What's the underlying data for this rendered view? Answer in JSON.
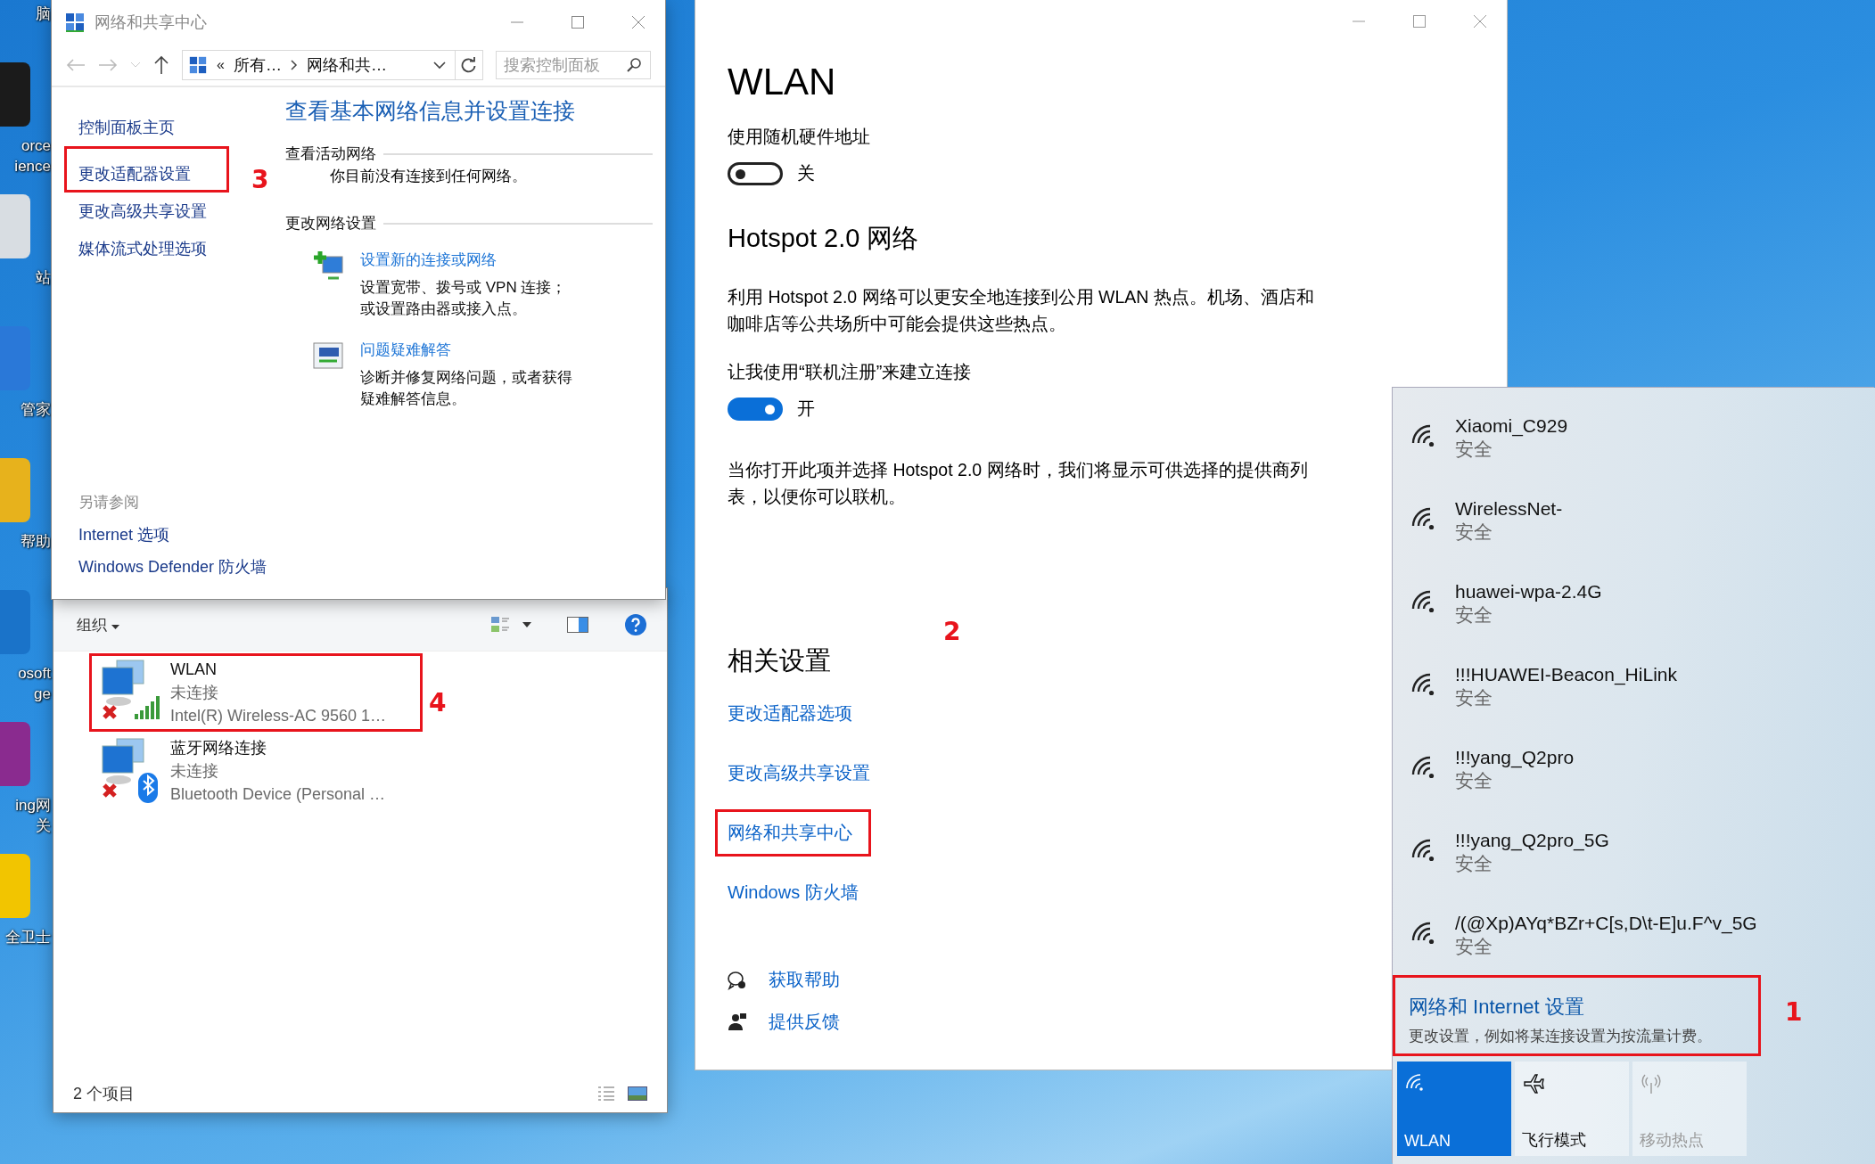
{
  "desktop_icons": [
    {
      "lines": [
        "脑"
      ]
    },
    {
      "lines": [
        "orce",
        "ience"
      ]
    },
    {
      "lines": [
        "站"
      ]
    },
    {
      "lines": [
        "管家"
      ]
    },
    {
      "lines": [
        "帮助"
      ]
    },
    {
      "lines": [
        "osoft",
        "ge"
      ]
    },
    {
      "lines": [
        "ing网",
        "关"
      ]
    },
    {
      "lines": [
        "全卫士"
      ]
    }
  ],
  "control_panel": {
    "title": "网络和共享中心",
    "breadcrumb_prefix": "«",
    "breadcrumb": [
      "所有…",
      "网络和共…"
    ],
    "search": {
      "placeholder": "搜索控制面板"
    },
    "nav": [
      {
        "label": "控制面板主页"
      },
      {
        "label": "更改适配器设置",
        "annotation": "3"
      },
      {
        "label": "更改高级共享设置"
      },
      {
        "label": "媒体流式处理选项"
      }
    ],
    "heading": "查看基本网络信息并设置连接",
    "active_networks": {
      "title": "查看活动网络",
      "text": "你目前没有连接到任何网络。"
    },
    "change_settings": {
      "title": "更改网络设置",
      "tasks": [
        {
          "kind": "new-connection",
          "link": "设置新的连接或网络",
          "lines": [
            "设置宽带、拨号或 VPN 连接；",
            "或设置路由器或接入点。"
          ]
        },
        {
          "kind": "troubleshoot",
          "link": "问题疑难解答",
          "lines": [
            "诊断并修复网络问题，或者获得",
            "疑难解答信息。"
          ]
        }
      ]
    },
    "see_also": {
      "title": "另请参阅",
      "links": [
        "Internet 选项",
        "Windows Defender 防火墙"
      ]
    }
  },
  "connections_window": {
    "organize": "组织",
    "items": [
      {
        "kind": "wifi",
        "name": "WLAN",
        "status": "未连接",
        "device": "Intel(R) Wireless-AC 9560 1…",
        "annotation": "4"
      },
      {
        "kind": "bluetooth",
        "name": "蓝牙网络连接",
        "status": "未连接",
        "device": "Bluetooth Device (Personal …"
      }
    ],
    "status": "2 个项目"
  },
  "settings": {
    "title": "WLAN",
    "random_address": {
      "label": "使用随机硬件地址",
      "on": false,
      "state": "关"
    },
    "hotspot": {
      "heading": "Hotspot 2.0 网络",
      "description": "利用 Hotspot 2.0 网络可以更安全地连接到公用 WLAN 热点。机场、酒店和咖啡店等公共场所中可能会提供这些热点。",
      "signup": {
        "label": "让我使用“联机注册”来建立连接",
        "on": true,
        "state": "开"
      },
      "note": "当你打开此项并选择 Hotspot 2.0 网络时，我们将显示可供选择的提供商列表，以便你可以联机。"
    },
    "related": {
      "heading": "相关设置",
      "annotation": "2",
      "links": [
        {
          "label": "更改适配器选项"
        },
        {
          "label": "更改高级共享设置"
        },
        {
          "label": "网络和共享中心",
          "annotation": true
        },
        {
          "label": "Windows 防火墙"
        }
      ]
    },
    "help": [
      {
        "kind": "help",
        "label": "获取帮助"
      },
      {
        "kind": "feedback",
        "label": "提供反馈"
      }
    ]
  },
  "flyout": {
    "networks": [
      {
        "name": "Xiaomi_C929",
        "status": "安全"
      },
      {
        "name": "WirelessNet-",
        "status": "安全"
      },
      {
        "name": "huawei-wpa-2.4G",
        "status": "安全"
      },
      {
        "name": "!!!HUAWEI-Beacon_HiLink",
        "status": "安全"
      },
      {
        "name": "!!!yang_Q2pro",
        "status": "安全"
      },
      {
        "name": "!!!yang_Q2pro_5G",
        "status": "安全"
      },
      {
        "name": "/(@Xp)AYq*BZr+C[s,D\\t-E]u.F^v_5G",
        "status": "安全"
      }
    ],
    "settings_link": {
      "title": "网络和 Internet 设置",
      "description": "更改设置，例如将某连接设置为按流量计费。",
      "annotation": "1"
    },
    "quick_actions": [
      {
        "kind": "wifi",
        "label": "WLAN",
        "on": true,
        "disabled": false
      },
      {
        "kind": "airplane",
        "label": "飞行模式",
        "on": false,
        "disabled": false
      },
      {
        "kind": "hotspot",
        "label": "移动热点",
        "on": false,
        "disabled": true
      }
    ]
  }
}
